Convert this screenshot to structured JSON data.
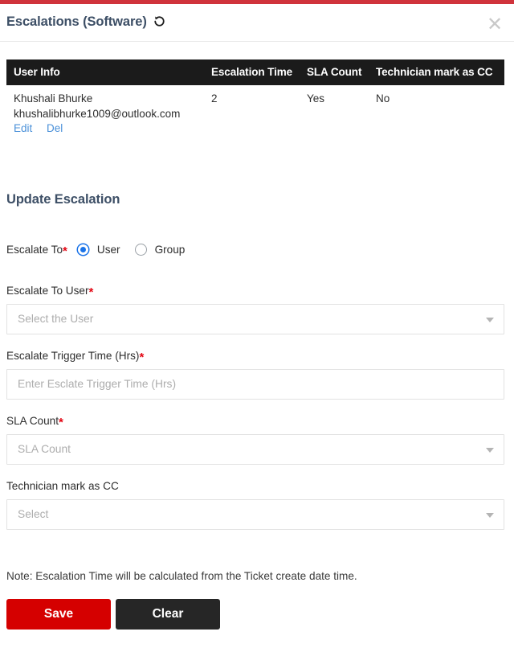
{
  "modal": {
    "title": "Escalations (Software)",
    "history_icon": "history-icon",
    "close_icon": "close-icon",
    "accent_color": "#d0333c"
  },
  "table": {
    "columns": [
      "User Info",
      "Escalation Time",
      "SLA Count",
      "Technician mark as CC"
    ],
    "rows": [
      {
        "name": "Khushali Bhurke",
        "email": "khushalibhurke1009@outlook.com",
        "edit_label": "Edit",
        "delete_label": "Del",
        "escalation_time": "2",
        "sla_count": "Yes",
        "technician_mark_as_cc": "No"
      }
    ]
  },
  "form": {
    "heading": "Update Escalation",
    "escalate_to": {
      "label": "Escalate To",
      "required": "*",
      "options": [
        {
          "label": "User",
          "selected": true
        },
        {
          "label": "Group",
          "selected": false
        }
      ]
    },
    "escalate_to_user": {
      "label": "Escalate To User",
      "required": "*",
      "placeholder": "Select the User",
      "value": ""
    },
    "escalate_trigger_time": {
      "label": "Escalate Trigger Time (Hrs)",
      "required": "*",
      "placeholder": "Enter Esclate Trigger Time (Hrs)",
      "value": ""
    },
    "sla_count": {
      "label": "SLA Count",
      "required": "*",
      "placeholder": "SLA Count",
      "value": ""
    },
    "technician_mark_as_cc": {
      "label": "Technician mark as CC",
      "required": "",
      "placeholder": "Select",
      "value": ""
    },
    "note": "Note: Escalation Time will be calculated from the Ticket create date time.",
    "save_label": "Save",
    "clear_label": "Clear",
    "save_color": "#d50000",
    "clear_color": "#262626",
    "link_color": "#4a90d9",
    "required_color": "#e30613"
  }
}
